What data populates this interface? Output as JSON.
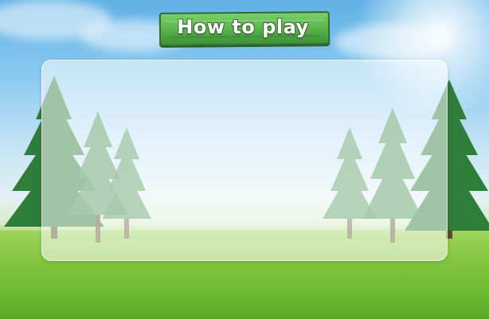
{
  "screen": {
    "title": "How to play"
  },
  "colors": {
    "plank": "#57b24a",
    "sky": "#8ccbf0",
    "grass": "#6cba30",
    "tree": "#2f7d3a"
  }
}
